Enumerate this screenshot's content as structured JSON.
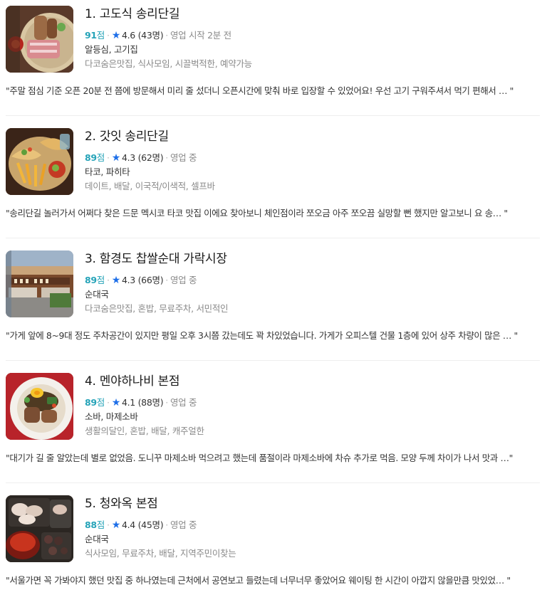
{
  "restaurants": [
    {
      "title": "1. 고도식 송리단길",
      "score": "91",
      "score_unit": "점",
      "rating": "4.6 (43명)",
      "status": "영업 시작 2분 전",
      "category": "알등심, 고기집",
      "tags": "다코숨은맛집, 식사모임, 시끌벅적한, 예약가능",
      "review": "\"주말 점심 기준 오픈 20분 전 쯤에 방문해서 미리 줄 섰더니 오픈시간에 맞춰 바로 입장할 수 있었어요! 우선 고기 구워주셔서 먹기 편해서 …  \"",
      "image_icon": "grilled-meat-photo"
    },
    {
      "title": "2. 갓잇 송리단길",
      "score": "89",
      "score_unit": "점",
      "rating": "4.3 (62명)",
      "status": "영업 중",
      "category": "타코, 파히타",
      "tags": "데이트, 배달, 이국적/이색적, 셀프바",
      "review": "\"송리단길 놀러가서 어쩌다 찾은 드문 멕시코 타코 맛집 이에요 찾아보니 체인점이라 쪼오금 아주 쪼오끔 실망할 뻔 했지만 알고보니 요 송…  \"",
      "image_icon": "taco-platter-photo"
    },
    {
      "title": "3. 함경도 찹쌀순대 가락시장",
      "score": "89",
      "score_unit": "점",
      "rating": "4.3 (66명)",
      "status": "영업 중",
      "category": "순대국",
      "tags": "다코숨은맛집, 혼밥, 무료주차, 서민적인",
      "review": "\"가게 앞에 8~9대 정도 주차공간이 있지만 평일 오후 3시쯤 갔는데도 꽉 차있었습니다. 가게가 오피스텔 건물 1층에 있어 상주 차량이 많은 …  \"",
      "image_icon": "storefront-photo"
    },
    {
      "title": "4. 멘야하나비 본점",
      "score": "89",
      "score_unit": "점",
      "rating": "4.1 (88명)",
      "status": "영업 중",
      "category": "소바, 마제소바",
      "tags": "생활의달인, 혼밥, 배달, 캐주얼한",
      "review": "\"대기가 길 줄 알았는데 별로 없었음. 도니꾸 마제소바 먹으려고 했는데 품절이라 마제소바에 차슈 추가로 먹음. 모양 두께 차이가 나서 맛과 …\"",
      "image_icon": "mazesoba-bowl-photo"
    },
    {
      "title": "5. 청와옥 본점",
      "score": "88",
      "score_unit": "점",
      "rating": "4.4 (45명)",
      "status": "영업 중",
      "category": "순대국",
      "tags": "식사모임, 무료주차, 배달, 지역주민이찾는",
      "review": "\"서울가면 꼭 가봐야지 했던 맛집 중 하나였는데 근처에서 공연보고 들렸는데 너무너무 좋았어요 웨이팅 한 시간이 아깝지 않을만큼 맛있었…  \"",
      "image_icon": "sundae-plate-photo"
    }
  ],
  "icons": {
    "star": "star-icon",
    "separator": "·"
  },
  "colors": {
    "score": "#25a3b8",
    "star": "#1e6fe8",
    "muted": "#8a8a8a"
  }
}
